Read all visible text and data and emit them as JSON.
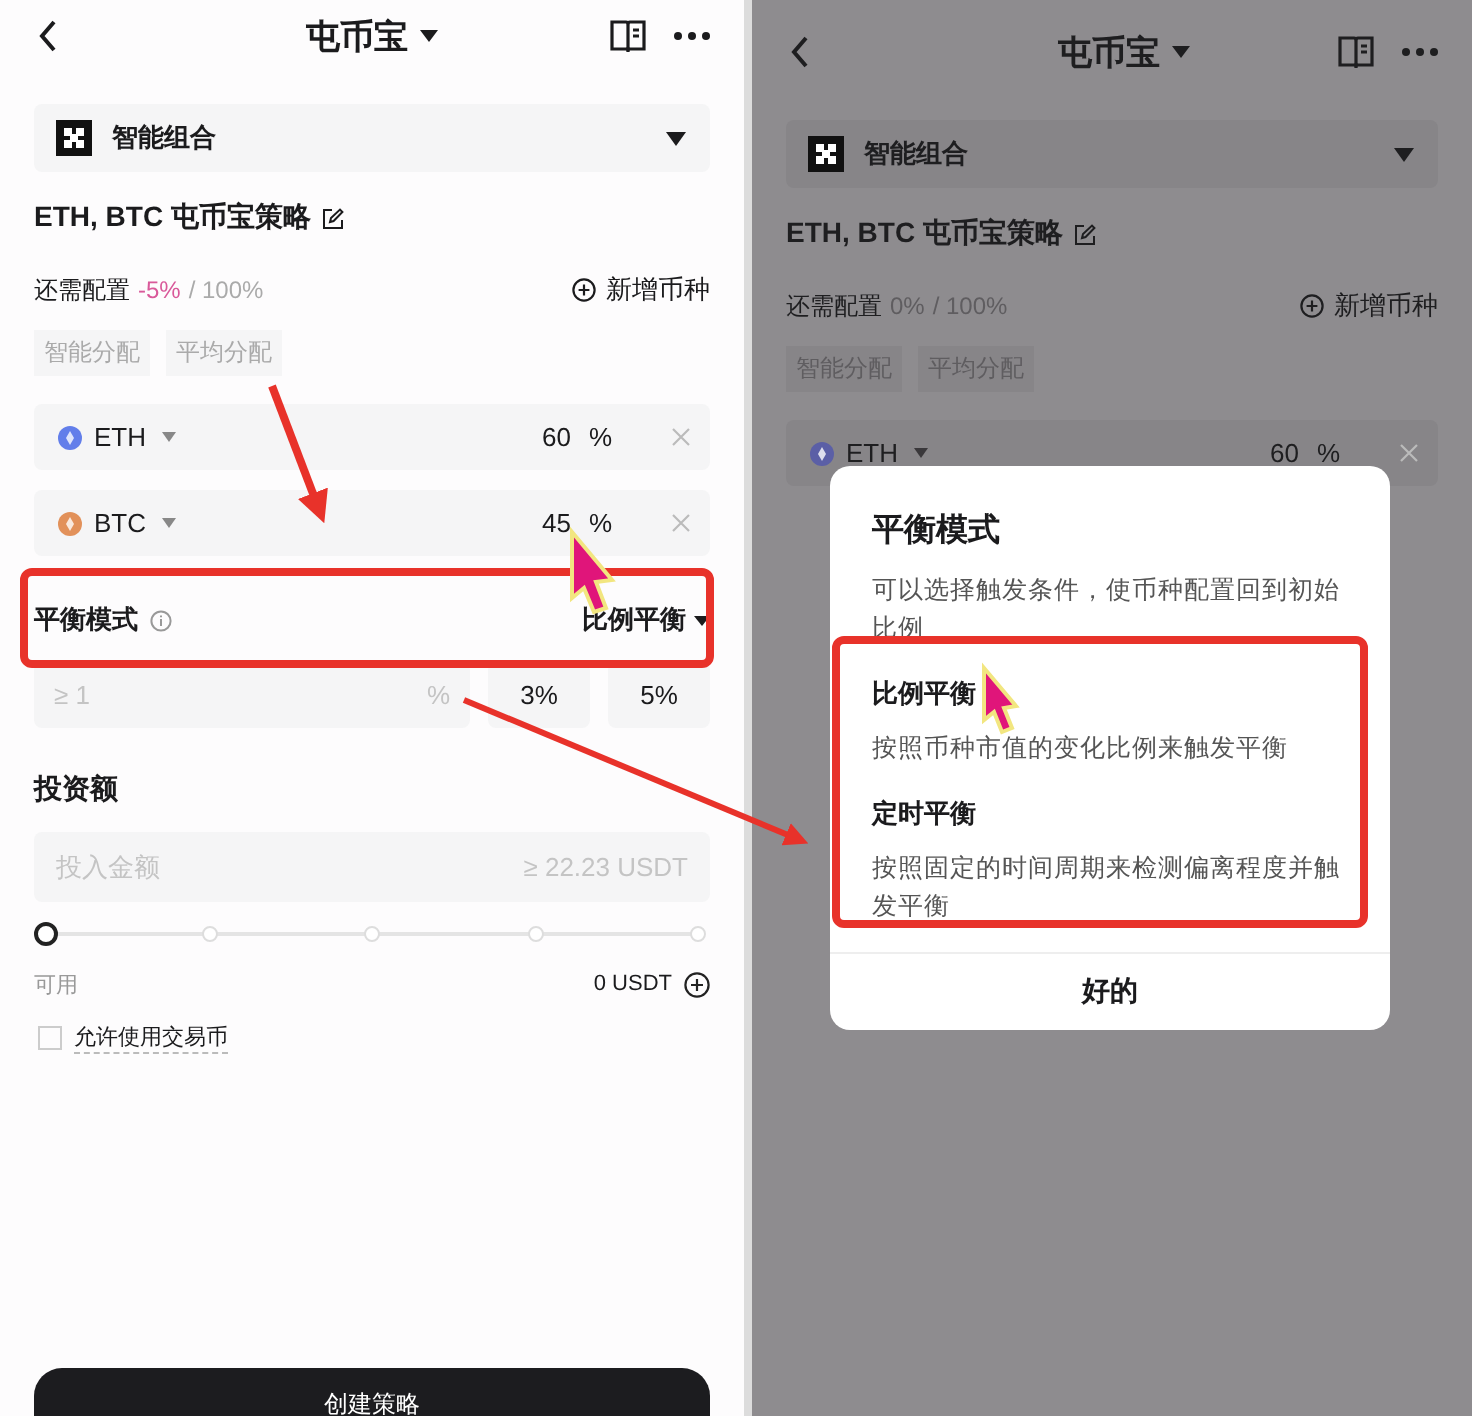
{
  "screens": [
    {
      "dimmed": false,
      "title": "屯币宝",
      "combo": "智能组合",
      "strategy_title": "ETH, BTC 屯币宝策略",
      "allocation": {
        "label": "还需配置",
        "value": "-5%",
        "over_allocated": true,
        "total": "/ 100%"
      },
      "add_coin": "新增币种",
      "presets": [
        "智能分配",
        "平均分配"
      ],
      "coins": [
        {
          "name": "ETH",
          "color": "#627eea",
          "value": "60",
          "unit": "%"
        },
        {
          "name": "BTC",
          "color": "#e2915a",
          "value": "45",
          "unit": "%"
        }
      ],
      "balance": {
        "label": "平衡模式",
        "mode": "比例平衡"
      },
      "threshold": {
        "placeholder": "≥ 1",
        "unit": "%",
        "options": [
          "3%",
          "5%"
        ]
      },
      "invest": {
        "label": "投资额",
        "placeholder": "投入金额",
        "hint": "≥ 22.23 USDT",
        "level": 0,
        "available_label": "可用",
        "available": "0 USDT"
      },
      "allow_trading_coin": {
        "label": "允许使用交易币",
        "checked": false
      },
      "submit": "创建策略"
    },
    {
      "dimmed": true,
      "title": "屯币宝",
      "combo": "智能组合",
      "strategy_title": "ETH, BTC 屯币宝策略",
      "allocation": {
        "label": "还需配置",
        "value": "0%",
        "over_allocated": false,
        "total": "/ 100%"
      },
      "add_coin": "新增币种",
      "presets": [
        "智能分配",
        "平均分配"
      ],
      "coins": [
        {
          "name": "ETH",
          "color": "#5b5fa6",
          "value": "60",
          "unit": "%"
        }
      ],
      "dialog": {
        "title": "平衡模式",
        "description": "可以选择触发条件，使币种配置回到初始比例",
        "options": [
          {
            "name": "比例平衡",
            "description": "按照币种市值的变化比例来触发平衡"
          },
          {
            "name": "定时平衡",
            "description": "按照固定的时间周期来检测偏离程度并触发平衡"
          }
        ],
        "confirm": "好的"
      }
    }
  ]
}
